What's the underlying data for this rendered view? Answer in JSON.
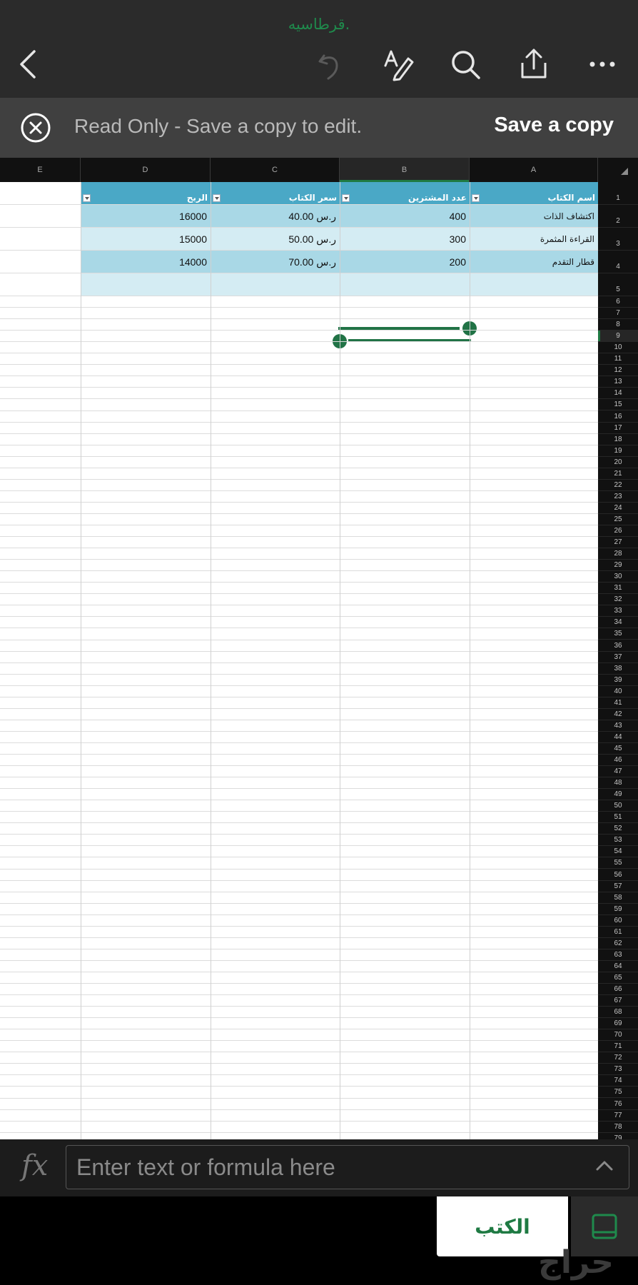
{
  "app": {
    "document_title": "قرطاسيه."
  },
  "banner": {
    "message": "Read Only - Save a copy to edit.",
    "save_label": "Save a copy"
  },
  "columns": [
    "E",
    "D",
    "C",
    "B",
    "A"
  ],
  "active_column": "B",
  "active_row": 9,
  "table": {
    "headers": {
      "A": "اسم الكتاب",
      "B": "عدد المشترين",
      "C": "سعر الكتاب",
      "D": "الربح"
    },
    "rows": [
      {
        "A": "اكتشاف الذات",
        "B": "400",
        "C": "ر.س 40.00",
        "D": "16000"
      },
      {
        "A": "القراءة المثمرة",
        "B": "300",
        "C": "ر.س 50.00",
        "D": "15000"
      },
      {
        "A": "قطار التقدم",
        "B": "200",
        "C": "ر.س 70.00",
        "D": "14000"
      }
    ]
  },
  "row_count": 79,
  "formula_bar": {
    "fx_label": "fx",
    "placeholder": "Enter text or formula here"
  },
  "sheet_tabs": {
    "active_tab": "الكتب"
  },
  "watermark": "حراج",
  "colors": {
    "accent_green": "#217346",
    "table_header": "#4aa8c6",
    "band_dark": "#a9d8e6",
    "band_light": "#d4ecf3"
  },
  "icons": [
    "back-chevron-icon",
    "undo-icon",
    "draw-pen-icon",
    "search-icon",
    "share-icon",
    "more-icon",
    "close-circle-icon",
    "chevron-up-icon",
    "sheet-list-icon"
  ]
}
